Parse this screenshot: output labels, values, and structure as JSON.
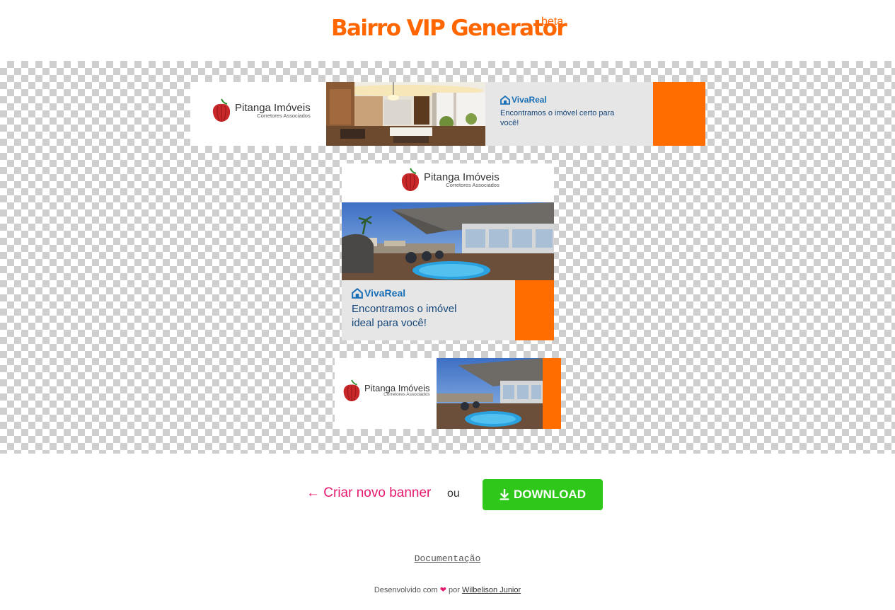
{
  "header": {
    "title": "Bairro VIP Generator",
    "badge": "beta"
  },
  "banners": {
    "logo_name": "Pitanga Imóveis",
    "logo_sub": "Corretores Associados",
    "brand": "VivaReal",
    "tagline_wide_1": "Encontramos o imóvel certo para",
    "tagline_wide_2": "você!",
    "tagline_medium_1": "Encontramos o imóvel",
    "tagline_medium_2": "ideal para você!"
  },
  "actions": {
    "create_label": "← Criar novo banner",
    "separator": "ou",
    "download_label": "DOWNLOAD"
  },
  "docs_link": "Documentação",
  "footer": {
    "prefix": "Desenvolvido com",
    "heart": "❤",
    "by": "por",
    "author": "Wilbelison Junior"
  },
  "colors": {
    "accent": "#ff6600",
    "banner_orange": "#ff6c00",
    "download": "#2fc81a",
    "link": "#e6196e"
  }
}
